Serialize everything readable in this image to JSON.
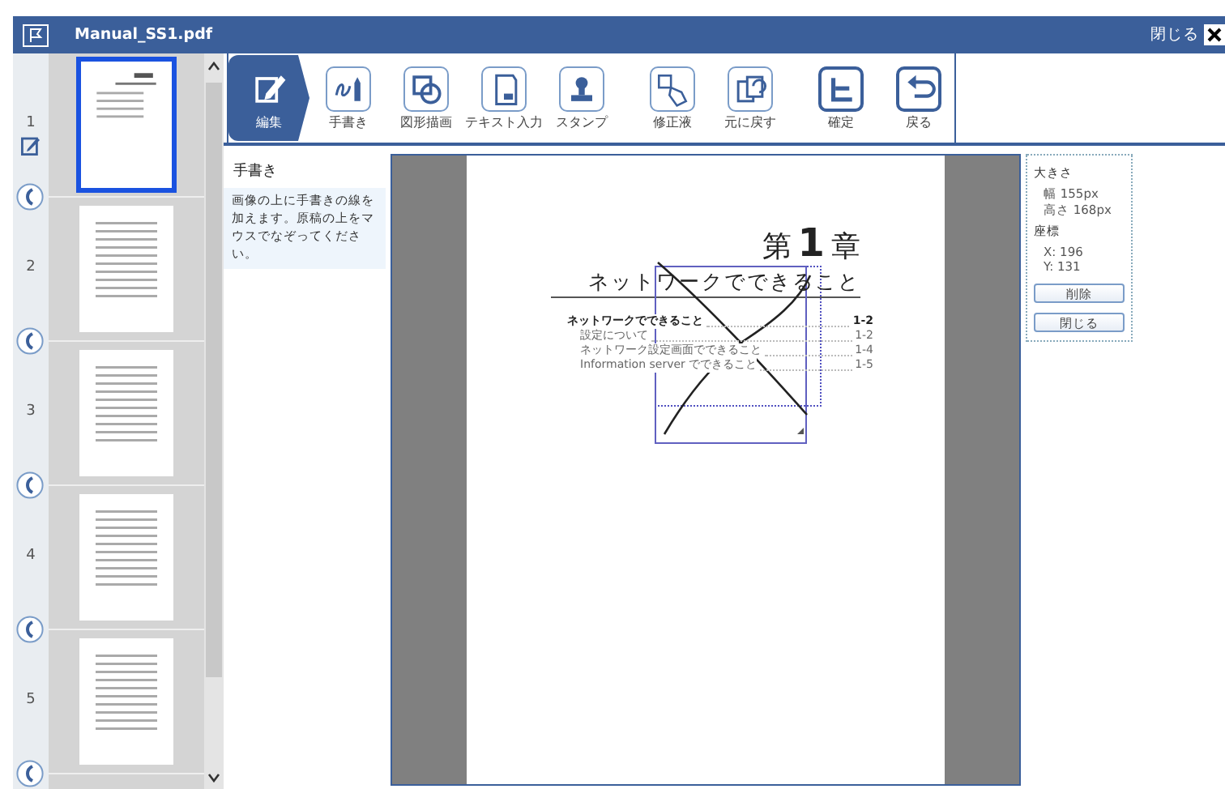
{
  "window": {
    "title": "Manual_SS1.pdf",
    "close_label": "閉じる"
  },
  "pages": [
    {
      "number": "1",
      "selected": true
    },
    {
      "number": "2",
      "selected": false
    },
    {
      "number": "3",
      "selected": false
    },
    {
      "number": "4",
      "selected": false
    },
    {
      "number": "5",
      "selected": false
    }
  ],
  "toolbar": {
    "groups": [
      [
        {
          "label": "編集",
          "selected": true
        },
        {
          "label": "手書き",
          "selected": false
        },
        {
          "label": "図形描画",
          "selected": false
        },
        {
          "label": "テキスト入力",
          "selected": false
        },
        {
          "label": "スタンプ",
          "selected": false
        }
      ],
      [
        {
          "label": "修正液",
          "selected": false
        },
        {
          "label": "元に戻す",
          "selected": false
        }
      ],
      [
        {
          "label": "確定",
          "selected": false
        },
        {
          "label": "戻る",
          "selected": false
        }
      ]
    ]
  },
  "help": {
    "title": "手書き",
    "text": "画像の上に手書きの線を加えます。原稿の上をマウスでなぞってください。"
  },
  "document": {
    "chapter_prefix": "第",
    "chapter_number": "1",
    "chapter_suffix": "章",
    "subtitle": "ネットワークでできること",
    "toc": [
      {
        "title": "ネットワークでできること",
        "page": "1-2",
        "kind": "heading"
      },
      {
        "title": "設定について",
        "page": "1-2",
        "kind": "entry"
      },
      {
        "title": "ネットワーク設定画面でできること",
        "page": "1-4",
        "kind": "entry"
      },
      {
        "title": "Information server でできること",
        "page": "1-5",
        "kind": "entry"
      }
    ]
  },
  "properties": {
    "size_label": "大きさ",
    "width": "幅 155px",
    "height": "高さ 168px",
    "position_label": "座標",
    "x": "X: 196",
    "y": "Y: 131",
    "buttons": [
      "削除",
      "閉じる"
    ]
  }
}
